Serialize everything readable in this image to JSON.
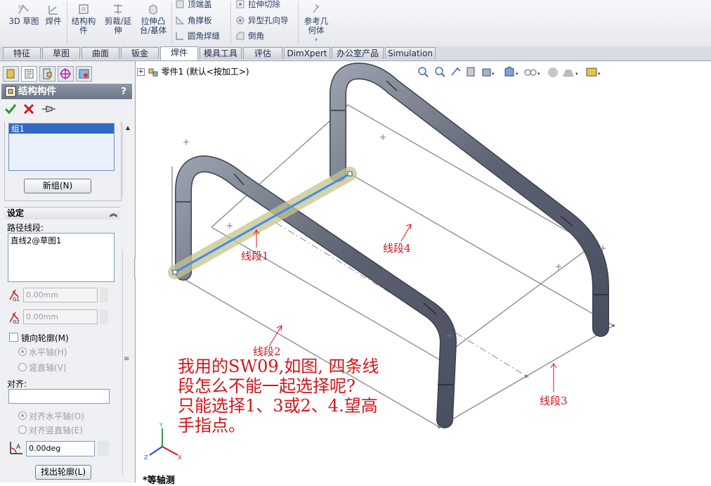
{
  "ribbon": {
    "sketch3d": "3D 草图",
    "weldment": "焊件",
    "structural_member": [
      "结构构",
      "件"
    ],
    "trim_extend": [
      "剪裁/延",
      "伸"
    ],
    "extruded_boss": [
      "拉伸凸",
      "台/基体"
    ],
    "end_cap": "顶端盖",
    "gusset": "角撑板",
    "fillet_bead": "圆角焊缝",
    "extruded_cut": "拉伸切除",
    "hole_wizard": "异型孔向导",
    "chamfer": "倒角",
    "ref_geometry": [
      "参考几",
      "何体"
    ]
  },
  "tabs": [
    "特征",
    "草图",
    "曲面",
    "钣金",
    "焊件",
    "模具工具",
    "评估",
    "DimXpert",
    "办公室产品",
    "Simulation"
  ],
  "active_tab": "焊件",
  "panel": {
    "title": "结构构件",
    "help": "?",
    "group_item": "组1",
    "new_group": "新组(N)",
    "settings_header": "设定",
    "path_label": "路径线段:",
    "path_value": "直线2@草图1",
    "g1_value": "0.00mm",
    "g2_value": "0.00mm",
    "mirror_profile": "镜向轮廓(M)",
    "horizontal_axis": "水平轴(H)",
    "vertical_axis": "竖直轴(V)",
    "align_label": "对齐:",
    "align_horizontal": "对齐水平轴(O)",
    "align_vertical": "对齐竖直轴(E)",
    "angle_value": "0.00deg",
    "locate_profile": "找出轮廓(L)"
  },
  "tree": {
    "part": "零件1 (默认<按加工>)"
  },
  "view": {
    "orientation": "*等轴测"
  },
  "annotations": {
    "seg1": "线段1",
    "seg2": "线段2",
    "seg3": "线段3",
    "seg4": "线段4",
    "message": [
      "我用的SW09,如图, 四条线",
      "段怎么不能一起选择呢?",
      "只能选择1、3或2、4.望高",
      "手指点。"
    ]
  },
  "colors": {
    "annotation": "#d4161b",
    "tube": "#6b7180",
    "selection": "#3e8cf0"
  }
}
